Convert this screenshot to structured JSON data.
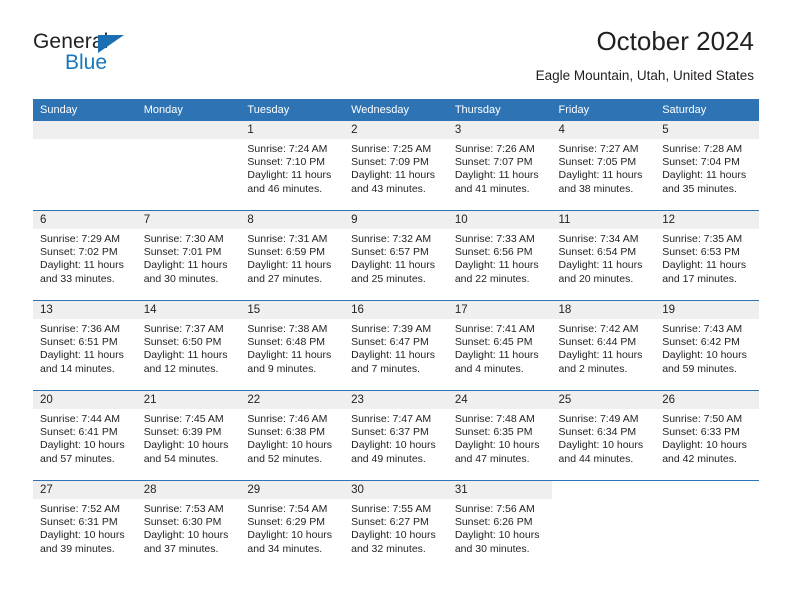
{
  "brand": {
    "name_part1": "General",
    "name_part2": "Blue",
    "triangle_color": "#1a6fb4",
    "blue_text_color": "#1878be"
  },
  "header": {
    "title": "October 2024",
    "subtitle": "Eagle Mountain, Utah, United States"
  },
  "theme": {
    "header_blue": "#2e74b5",
    "daynum_background": "#efefef",
    "text_color": "#231f20"
  },
  "calendar": {
    "weekday_headers": [
      "Sunday",
      "Monday",
      "Tuesday",
      "Wednesday",
      "Thursday",
      "Friday",
      "Saturday"
    ],
    "labels": {
      "sunrise": "Sunrise:",
      "sunset": "Sunset:",
      "daylight": "Daylight:"
    },
    "weeks": [
      [
        {
          "day": "",
          "sunrise": "",
          "sunset": "",
          "daylight": "",
          "empty": true,
          "leading": true
        },
        {
          "day": "",
          "sunrise": "",
          "sunset": "",
          "daylight": "",
          "empty": true,
          "leading": true
        },
        {
          "day": "1",
          "sunrise": "Sunrise: 7:24 AM",
          "sunset": "Sunset: 7:10 PM",
          "daylight": "Daylight: 11 hours and 46 minutes."
        },
        {
          "day": "2",
          "sunrise": "Sunrise: 7:25 AM",
          "sunset": "Sunset: 7:09 PM",
          "daylight": "Daylight: 11 hours and 43 minutes."
        },
        {
          "day": "3",
          "sunrise": "Sunrise: 7:26 AM",
          "sunset": "Sunset: 7:07 PM",
          "daylight": "Daylight: 11 hours and 41 minutes."
        },
        {
          "day": "4",
          "sunrise": "Sunrise: 7:27 AM",
          "sunset": "Sunset: 7:05 PM",
          "daylight": "Daylight: 11 hours and 38 minutes."
        },
        {
          "day": "5",
          "sunrise": "Sunrise: 7:28 AM",
          "sunset": "Sunset: 7:04 PM",
          "daylight": "Daylight: 11 hours and 35 minutes."
        }
      ],
      [
        {
          "day": "6",
          "sunrise": "Sunrise: 7:29 AM",
          "sunset": "Sunset: 7:02 PM",
          "daylight": "Daylight: 11 hours and 33 minutes."
        },
        {
          "day": "7",
          "sunrise": "Sunrise: 7:30 AM",
          "sunset": "Sunset: 7:01 PM",
          "daylight": "Daylight: 11 hours and 30 minutes."
        },
        {
          "day": "8",
          "sunrise": "Sunrise: 7:31 AM",
          "sunset": "Sunset: 6:59 PM",
          "daylight": "Daylight: 11 hours and 27 minutes."
        },
        {
          "day": "9",
          "sunrise": "Sunrise: 7:32 AM",
          "sunset": "Sunset: 6:57 PM",
          "daylight": "Daylight: 11 hours and 25 minutes."
        },
        {
          "day": "10",
          "sunrise": "Sunrise: 7:33 AM",
          "sunset": "Sunset: 6:56 PM",
          "daylight": "Daylight: 11 hours and 22 minutes."
        },
        {
          "day": "11",
          "sunrise": "Sunrise: 7:34 AM",
          "sunset": "Sunset: 6:54 PM",
          "daylight": "Daylight: 11 hours and 20 minutes."
        },
        {
          "day": "12",
          "sunrise": "Sunrise: 7:35 AM",
          "sunset": "Sunset: 6:53 PM",
          "daylight": "Daylight: 11 hours and 17 minutes."
        }
      ],
      [
        {
          "day": "13",
          "sunrise": "Sunrise: 7:36 AM",
          "sunset": "Sunset: 6:51 PM",
          "daylight": "Daylight: 11 hours and 14 minutes."
        },
        {
          "day": "14",
          "sunrise": "Sunrise: 7:37 AM",
          "sunset": "Sunset: 6:50 PM",
          "daylight": "Daylight: 11 hours and 12 minutes."
        },
        {
          "day": "15",
          "sunrise": "Sunrise: 7:38 AM",
          "sunset": "Sunset: 6:48 PM",
          "daylight": "Daylight: 11 hours and 9 minutes."
        },
        {
          "day": "16",
          "sunrise": "Sunrise: 7:39 AM",
          "sunset": "Sunset: 6:47 PM",
          "daylight": "Daylight: 11 hours and 7 minutes."
        },
        {
          "day": "17",
          "sunrise": "Sunrise: 7:41 AM",
          "sunset": "Sunset: 6:45 PM",
          "daylight": "Daylight: 11 hours and 4 minutes."
        },
        {
          "day": "18",
          "sunrise": "Sunrise: 7:42 AM",
          "sunset": "Sunset: 6:44 PM",
          "daylight": "Daylight: 11 hours and 2 minutes."
        },
        {
          "day": "19",
          "sunrise": "Sunrise: 7:43 AM",
          "sunset": "Sunset: 6:42 PM",
          "daylight": "Daylight: 10 hours and 59 minutes."
        }
      ],
      [
        {
          "day": "20",
          "sunrise": "Sunrise: 7:44 AM",
          "sunset": "Sunset: 6:41 PM",
          "daylight": "Daylight: 10 hours and 57 minutes."
        },
        {
          "day": "21",
          "sunrise": "Sunrise: 7:45 AM",
          "sunset": "Sunset: 6:39 PM",
          "daylight": "Daylight: 10 hours and 54 minutes."
        },
        {
          "day": "22",
          "sunrise": "Sunrise: 7:46 AM",
          "sunset": "Sunset: 6:38 PM",
          "daylight": "Daylight: 10 hours and 52 minutes."
        },
        {
          "day": "23",
          "sunrise": "Sunrise: 7:47 AM",
          "sunset": "Sunset: 6:37 PM",
          "daylight": "Daylight: 10 hours and 49 minutes."
        },
        {
          "day": "24",
          "sunrise": "Sunrise: 7:48 AM",
          "sunset": "Sunset: 6:35 PM",
          "daylight": "Daylight: 10 hours and 47 minutes."
        },
        {
          "day": "25",
          "sunrise": "Sunrise: 7:49 AM",
          "sunset": "Sunset: 6:34 PM",
          "daylight": "Daylight: 10 hours and 44 minutes."
        },
        {
          "day": "26",
          "sunrise": "Sunrise: 7:50 AM",
          "sunset": "Sunset: 6:33 PM",
          "daylight": "Daylight: 10 hours and 42 minutes."
        }
      ],
      [
        {
          "day": "27",
          "sunrise": "Sunrise: 7:52 AM",
          "sunset": "Sunset: 6:31 PM",
          "daylight": "Daylight: 10 hours and 39 minutes."
        },
        {
          "day": "28",
          "sunrise": "Sunrise: 7:53 AM",
          "sunset": "Sunset: 6:30 PM",
          "daylight": "Daylight: 10 hours and 37 minutes."
        },
        {
          "day": "29",
          "sunrise": "Sunrise: 7:54 AM",
          "sunset": "Sunset: 6:29 PM",
          "daylight": "Daylight: 10 hours and 34 minutes."
        },
        {
          "day": "30",
          "sunrise": "Sunrise: 7:55 AM",
          "sunset": "Sunset: 6:27 PM",
          "daylight": "Daylight: 10 hours and 32 minutes."
        },
        {
          "day": "31",
          "sunrise": "Sunrise: 7:56 AM",
          "sunset": "Sunset: 6:26 PM",
          "daylight": "Daylight: 10 hours and 30 minutes."
        },
        {
          "day": "",
          "sunrise": "",
          "sunset": "",
          "daylight": "",
          "empty": true,
          "trailing": true
        },
        {
          "day": "",
          "sunrise": "",
          "sunset": "",
          "daylight": "",
          "empty": true,
          "trailing": true
        }
      ]
    ]
  }
}
